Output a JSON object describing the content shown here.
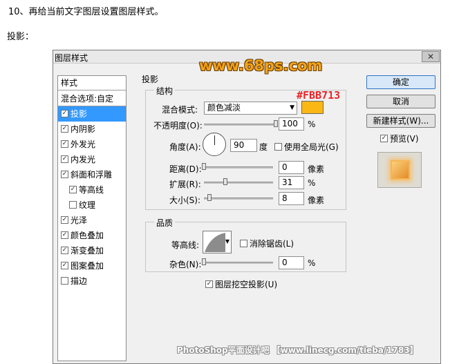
{
  "intro": "10、再给当前文字图层设置图层样式。",
  "subhead": "投影：",
  "dialog": {
    "title": "图层样式",
    "close_glyph": "✕"
  },
  "watermark_top": "www.68ps.com",
  "styles_panel": {
    "header": "样式",
    "items": [
      {
        "label": "混合选项:自定",
        "checkbox": false,
        "checked": false,
        "selected": false,
        "indent": false
      },
      {
        "label": "投影",
        "checkbox": true,
        "checked": true,
        "selected": true,
        "indent": false
      },
      {
        "label": "内阴影",
        "checkbox": true,
        "checked": true,
        "selected": false,
        "indent": false
      },
      {
        "label": "外发光",
        "checkbox": true,
        "checked": true,
        "selected": false,
        "indent": false
      },
      {
        "label": "内发光",
        "checkbox": true,
        "checked": true,
        "selected": false,
        "indent": false
      },
      {
        "label": "斜面和浮雕",
        "checkbox": true,
        "checked": true,
        "selected": false,
        "indent": false
      },
      {
        "label": "等高线",
        "checkbox": true,
        "checked": true,
        "selected": false,
        "indent": true
      },
      {
        "label": "纹理",
        "checkbox": true,
        "checked": false,
        "selected": false,
        "indent": true
      },
      {
        "label": "光泽",
        "checkbox": true,
        "checked": true,
        "selected": false,
        "indent": false
      },
      {
        "label": "颜色叠加",
        "checkbox": true,
        "checked": true,
        "selected": false,
        "indent": false
      },
      {
        "label": "渐变叠加",
        "checkbox": true,
        "checked": true,
        "selected": false,
        "indent": false
      },
      {
        "label": "图案叠加",
        "checkbox": true,
        "checked": true,
        "selected": false,
        "indent": false
      },
      {
        "label": "描边",
        "checkbox": true,
        "checked": false,
        "selected": false,
        "indent": false
      }
    ]
  },
  "drop_shadow": {
    "section": "投影",
    "structure": {
      "title": "结构",
      "blend_mode_label": "混合模式:",
      "blend_mode_value": "颜色减淡",
      "color": "#FBB713",
      "color_annotation": "#FBB713",
      "opacity_label": "不透明度(O):",
      "opacity_value": "100",
      "opacity_unit": "%",
      "opacity_level": 1.0,
      "angle_label": "角度(A):",
      "angle_value": "90",
      "angle_unit": "度",
      "global_light_label": "使用全局光(G)",
      "global_light_checked": false,
      "distance_label": "距离(D):",
      "distance_value": "0",
      "distance_unit": "像素",
      "distance_level": 0.0,
      "spread_label": "扩展(R):",
      "spread_value": "31",
      "spread_unit": "%",
      "spread_level": 0.31,
      "size_label": "大小(S):",
      "size_value": "8",
      "size_unit": "像素",
      "size_level": 0.08
    },
    "quality": {
      "title": "品质",
      "contour_label": "等高线:",
      "anti_alias_label": "消除锯齿(L)",
      "anti_alias_checked": false,
      "noise_label": "杂色(N):",
      "noise_value": "0",
      "noise_unit": "%",
      "noise_level": 0.0
    },
    "knockout_label": "图层挖空投影(U)",
    "knockout_checked": true
  },
  "buttons": {
    "ok": "确定",
    "cancel": "取消",
    "new_style": "新建样式(W)...",
    "preview_label": "预览(V)",
    "preview_checked": true
  },
  "footer_watermark": "PhotoShop平面设计吧 【www.linecg.com/tieba/1783】"
}
